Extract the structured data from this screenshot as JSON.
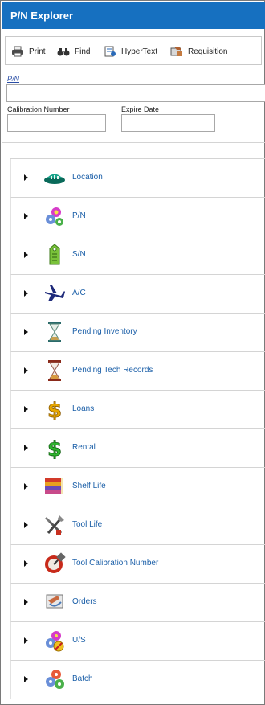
{
  "window": {
    "title": "P/N Explorer"
  },
  "toolbar": {
    "items": [
      {
        "label": "Print",
        "icon": "printer-icon"
      },
      {
        "label": "Find",
        "icon": "binoculars-icon"
      },
      {
        "label": "HyperText",
        "icon": "hypertext-icon"
      },
      {
        "label": "Requisition",
        "icon": "requisition-icon"
      }
    ]
  },
  "form": {
    "pn_label": "P/N",
    "pn_value": "",
    "calibration_label": "Calibration Number",
    "calibration_value": "",
    "expire_label": "Expire Date",
    "expire_value": ""
  },
  "tree": {
    "selected_index": 7,
    "items": [
      {
        "label": "Location",
        "icon": "location-icon"
      },
      {
        "label": "P/N",
        "icon": "flower-gears-icon"
      },
      {
        "label": "S/N",
        "icon": "tag-icon"
      },
      {
        "label": "A/C",
        "icon": "airplane-icon"
      },
      {
        "label": "Pending Inventory",
        "icon": "hourglass-icon"
      },
      {
        "label": "Pending Tech Records",
        "icon": "hourglass-red-icon"
      },
      {
        "label": "Loans",
        "icon": "dollar-gold-icon"
      },
      {
        "label": "Rental",
        "icon": "dollar-green-icon"
      },
      {
        "label": "Shelf Life",
        "icon": "books-icon"
      },
      {
        "label": "Tool Life",
        "icon": "tools-icon"
      },
      {
        "label": "Tool Calibration Number",
        "icon": "calibration-icon"
      },
      {
        "label": "Orders",
        "icon": "orders-icon"
      },
      {
        "label": "U/S",
        "icon": "unserviceable-icon"
      },
      {
        "label": "Batch",
        "icon": "batch-icon"
      }
    ]
  },
  "colors": {
    "titlebar": "#1670c0",
    "link": "#1b5fa8",
    "selection": "#1a6f82"
  }
}
